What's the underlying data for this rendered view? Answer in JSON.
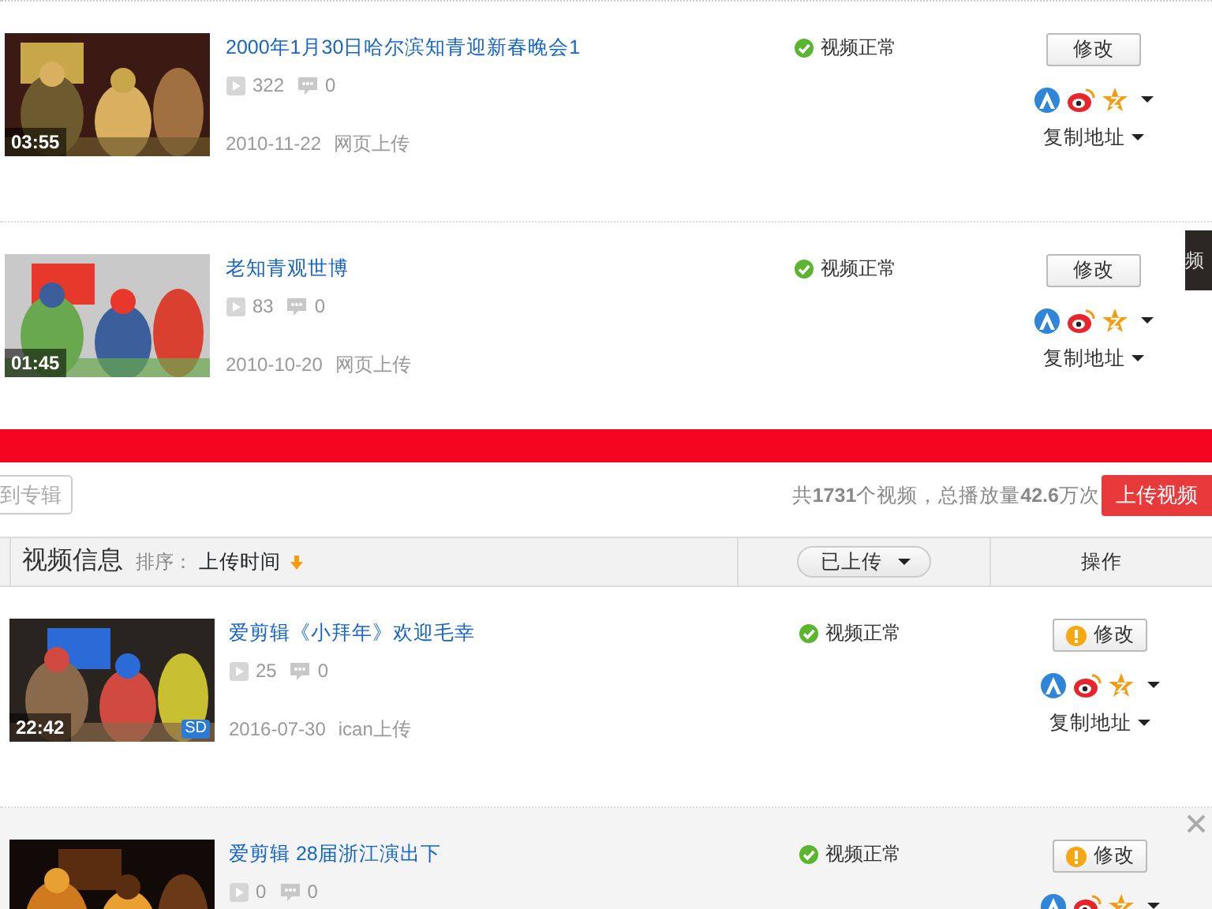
{
  "top_rows": [
    {
      "title": "2000年1月30日哈尔滨知青迎新春晚会1",
      "duration": "03:55",
      "plays": "322",
      "comments": "0",
      "date": "2010-11-22",
      "source": "网页上传",
      "status": "视频正常",
      "edit_label": "修改",
      "warning": false,
      "copy_label": "复制地址",
      "hovered": false
    },
    {
      "title": "老知青观世博",
      "duration": "01:45",
      "plays": "83",
      "comments": "0",
      "date": "2010-10-20",
      "source": "网页上传",
      "status": "视频正常",
      "edit_label": "修改",
      "warning": false,
      "copy_label": "复制地址",
      "hovered": false
    }
  ],
  "side_tab": "频",
  "toolbar": {
    "move_button": "到专辑",
    "summary": "共**1731**个视频，总播放量**42.6**万次",
    "upload_button": "上传视频"
  },
  "header": {
    "info": "视频信息",
    "sort_label": "排序：",
    "sort_value": "上传时间",
    "filter": "已上传",
    "ops": "操作"
  },
  "rows": [
    {
      "title": "爱剪辑《小拜年》欢迎毛幸",
      "duration": "22:42",
      "badge": "SD",
      "plays": "25",
      "comments": "0",
      "date": "2016-07-30",
      "source": "ican上传",
      "status": "视频正常",
      "edit_label": "修改",
      "warning": true,
      "copy_label": "复制地址",
      "hovered": false
    },
    {
      "title": "爱剪辑 28届浙江演出下",
      "plays": "0",
      "comments": "0",
      "status": "视频正常",
      "edit_label": "修改",
      "warning": true,
      "hovered": true
    }
  ]
}
